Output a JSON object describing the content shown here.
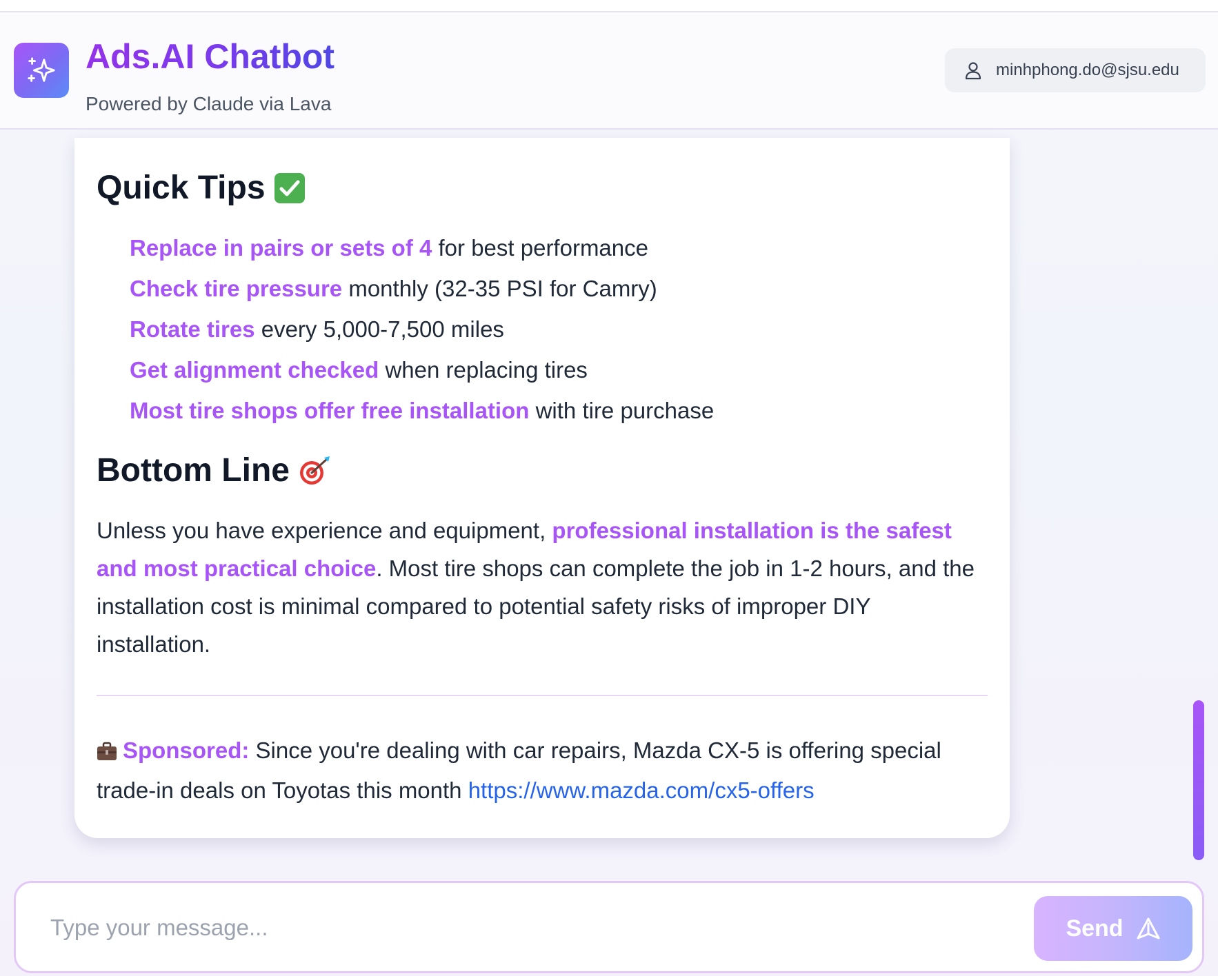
{
  "header": {
    "title": "Ads.AI Chatbot",
    "subtitle": "Powered by Claude via Lava",
    "logo_icon": "sparkles-icon",
    "user_email": "minhphong.do@sjsu.edu",
    "user_icon": "user-icon"
  },
  "message": {
    "quick_tips": {
      "heading": "Quick Tips",
      "heading_emoji": "check-mark-button-emoji",
      "items": [
        {
          "bold": "Replace in pairs or sets of 4",
          "rest": " for best performance"
        },
        {
          "bold": "Check tire pressure",
          "rest": " monthly (32-35 PSI for Camry)"
        },
        {
          "bold": "Rotate tires",
          "rest": " every 5,000-7,500 miles"
        },
        {
          "bold": "Get alignment checked",
          "rest": " when replacing tires"
        },
        {
          "bold": "Most tire shops offer free installation",
          "rest": " with tire purchase"
        }
      ]
    },
    "bottom_line": {
      "heading": "Bottom Line",
      "heading_emoji": "direct-hit-emoji",
      "text_before": "Unless you have experience and equipment, ",
      "text_bold": "professional installation is the safest and most practical choice",
      "text_after": ". Most tire shops can complete the job in 1-2 hours, and the installation cost is minimal compared to potential safety risks of improper DIY installation."
    },
    "sponsored": {
      "icon": "briefcase-emoji",
      "label": "Sponsored:",
      "text": " Since you're dealing with car repairs, Mazda CX-5 is offering special trade-in deals on Toyotas this month ",
      "link": "https://www.mazda.com/cx5-offers"
    }
  },
  "composer": {
    "placeholder": "Type your message...",
    "value": "",
    "send_label": "Send",
    "send_icon": "send-icon"
  },
  "colors": {
    "accent_purple": "#a855f7",
    "link_blue": "#2563eb",
    "title_gradient_start": "#9333ea",
    "title_gradient_end": "#4f46e5"
  }
}
